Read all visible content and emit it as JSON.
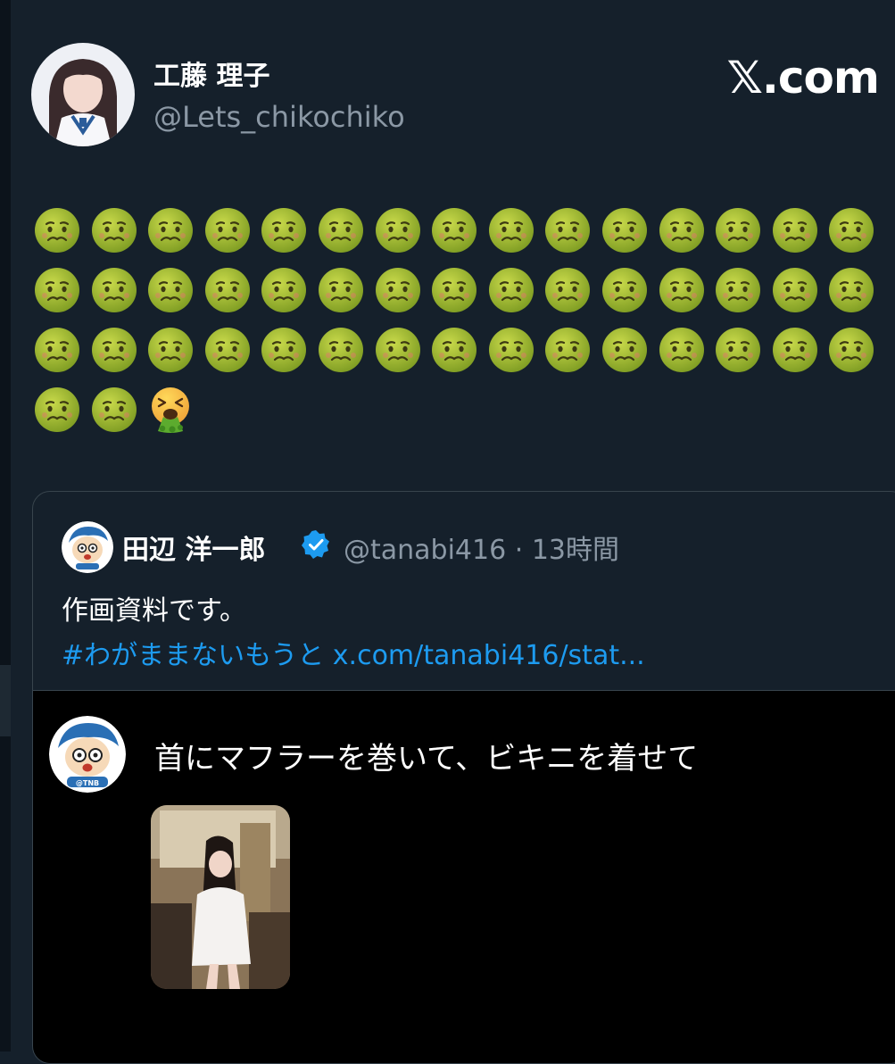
{
  "post": {
    "author_name": "工藤 理子",
    "author_handle": "@Lets_chikochiko",
    "brand": "𝕏.com",
    "emoji_text": "🤢🤢🤢🤢🤢🤢🤢🤢🤢🤢🤢🤢🤢🤢🤢🤢🤢🤢🤢🤢🤢🤢🤢🤢🤢🤢🤢🤢🤢🤢🤢🤢🤢🤢🤢🤢🤢🤢🤢🤢🤢🤢🤢🤢🤢🤢🤢🤮",
    "nauseated_count": 47,
    "vomiting_count": 1
  },
  "quote": {
    "author_name": "田辺 洋一郎",
    "verified": true,
    "handle": "@tanabi416",
    "separator": "·",
    "time": "13時間",
    "text": "作画資料です。",
    "hashtag": "#わがままないもうと",
    "link": "x.com/tanabi416/stat..."
  },
  "media": {
    "avatar_badge": "@TNB",
    "text": "首にマフラーを巻いて、ビキニを着せて"
  },
  "colors": {
    "background": "#15202b",
    "media_background": "#000000",
    "border": "#38444d",
    "secondary_text": "#8b98a5",
    "link": "#1d9bf0",
    "verified_badge": "#1d9bf0"
  },
  "icons": {
    "nauseated": "nauseated-face-icon",
    "vomiting": "face-vomiting-icon",
    "verified": "verified-badge-icon"
  }
}
